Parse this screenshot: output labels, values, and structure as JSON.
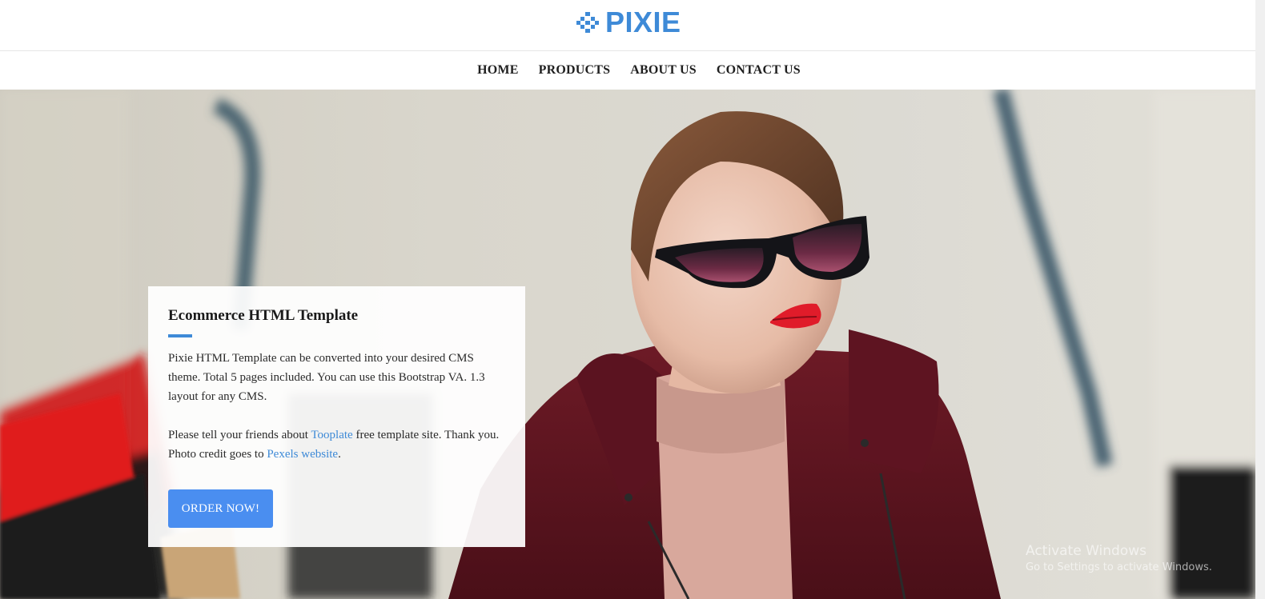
{
  "logo": {
    "text": "PIXIE",
    "icon": "pixel-diamond-logo-icon",
    "color": "#3e8ad7"
  },
  "nav": {
    "items": [
      {
        "label": "HOME"
      },
      {
        "label": "PRODUCTS"
      },
      {
        "label": "ABOUT US"
      },
      {
        "label": "CONTACT US"
      }
    ]
  },
  "hero": {
    "card": {
      "title": "Ecommerce HTML Template",
      "paragraph1": "Pixie HTML Template can be converted into your desired CMS theme. Total 5 pages included. You can use this Bootstrap VA. 1.3 layout for any CMS.",
      "paragraph2": {
        "text_before": "Please tell your friends about ",
        "link1": "Tooplate",
        "text_middle": " free template site. Thank you. Photo credit goes to ",
        "link2": "Pexels website",
        "text_after": "."
      },
      "button_label": "ORDER NOW!"
    }
  },
  "watermark": {
    "line1": "Activate Windows",
    "line2": "Go to Settings to activate Windows."
  },
  "colors": {
    "accent": "#3e8ad7",
    "button": "#4a8ef0"
  }
}
